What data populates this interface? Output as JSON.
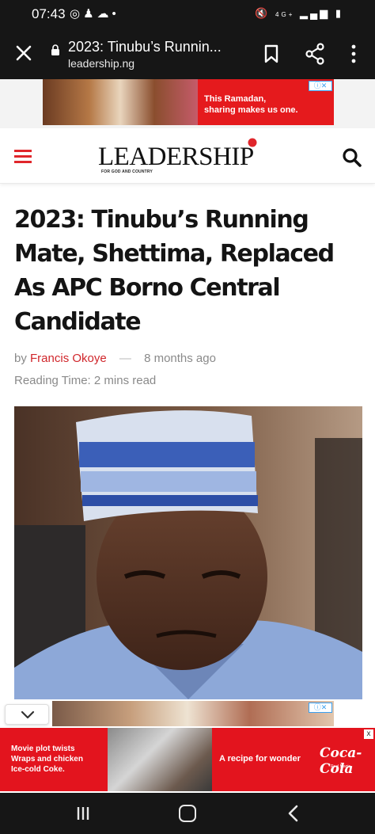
{
  "status_bar": {
    "time": "07:43",
    "left_icons": [
      "whatsapp-icon",
      "contacts-icon",
      "cloud-icon",
      "dot"
    ],
    "right_icons": [
      "mute-icon",
      "4g-icon",
      "signal-icon",
      "battery-icon"
    ],
    "network_label": "4G+"
  },
  "browser": {
    "page_title": "2023: Tinubu’s Runnin...",
    "domain": "leadership.ng"
  },
  "top_ad": {
    "text_line1": "This Ramadan,",
    "text_line2": "sharing makes us one.",
    "badge": "ⓘ✕"
  },
  "site_header": {
    "logo": "LEADERSHIP",
    "tagline": "FOR GOD AND COUNTRY",
    "accent_color": "#e0262b"
  },
  "article": {
    "headline": "2023: Tinubu’s Running Mate, Shettima, Replaced As APC Borno Central Candidate",
    "by_label": "by",
    "author": "Francis Okoye",
    "separator": "—",
    "time_ago": "8 months ago",
    "reading_time": "Reading Time: 2 mins read"
  },
  "bottom_ad": {
    "collapse_icon": "chevron-down-icon",
    "badge": "ⓘ✕",
    "left_text_line1": "Movie plot twists",
    "left_text_line2": "Wraps and chicken",
    "left_text_line3": "Ice-cold Coke.",
    "right_text": "A recipe for wonder",
    "brand": "Coca-Cola",
    "brand_sub": "Real Magic",
    "close": "x"
  },
  "nav_bar": {
    "icons": [
      "recents-icon",
      "home-icon",
      "back-icon"
    ]
  }
}
